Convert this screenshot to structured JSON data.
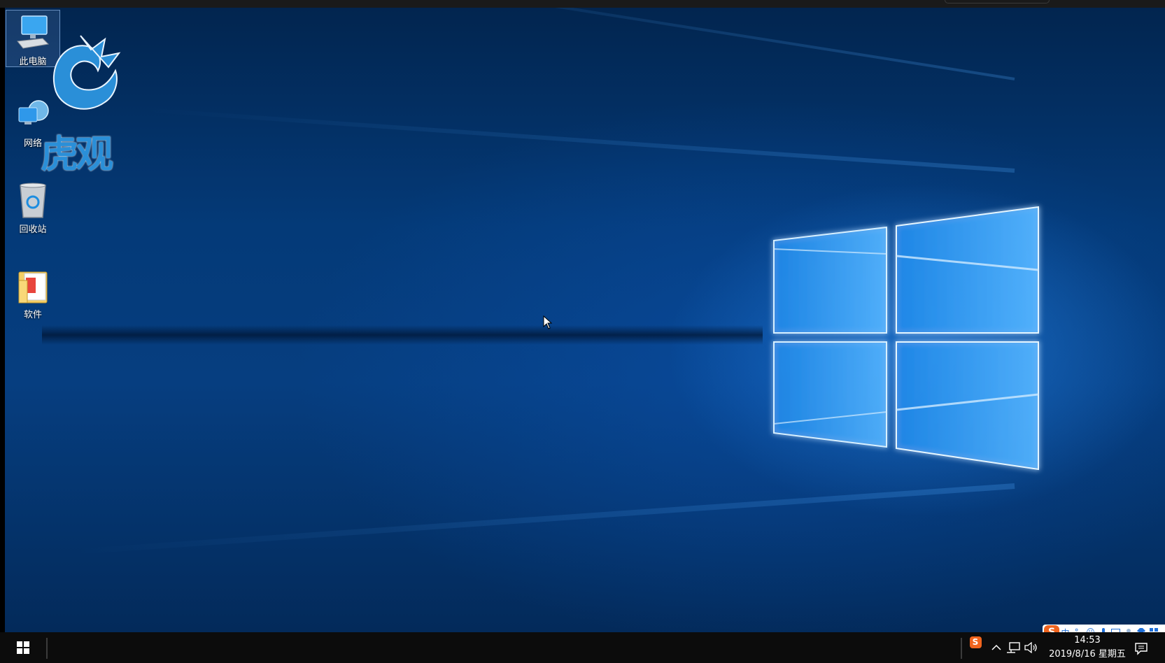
{
  "desktop": {
    "icons": [
      {
        "label": "此电脑",
        "icon": "computer-icon"
      },
      {
        "label": "网络",
        "icon": "network-icon"
      },
      {
        "label": "回收站",
        "icon": "recycle-bin-icon"
      },
      {
        "label": "软件",
        "icon": "folder-icon"
      }
    ],
    "watermark": {
      "text": "虎观"
    }
  },
  "ime": {
    "logo": "S",
    "mode": "中",
    "punct": "°,"
  },
  "taskbar": {
    "clock": {
      "time": "14:53",
      "date": "2019/8/16 星期五"
    }
  },
  "colors": {
    "accent": "#1e6fd9",
    "taskbar_bg": "#0c0c0c",
    "ime_logo": "#f0641e"
  }
}
